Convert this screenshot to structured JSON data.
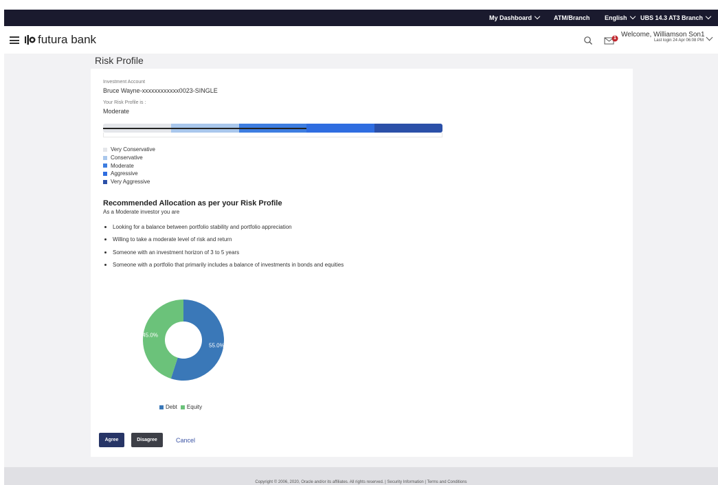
{
  "topbar": {
    "dashboard": "My Dashboard",
    "atm_branch": "ATM/Branch",
    "language": "English",
    "branch": "UBS 14.3 AT3 Branch"
  },
  "header": {
    "brand": "futura bank",
    "notification_count": "1",
    "welcome": "Welcome, Williamson Son1",
    "last_login": "Last login 24 Apr 06:08 PM"
  },
  "page": {
    "title": "Risk Profile"
  },
  "account": {
    "label": "Investment Account",
    "value": "Bruce Wayne-xxxxxxxxxxxx0023-SINGLE"
  },
  "risk": {
    "label": "Your Risk Profile is :",
    "value": "Moderate",
    "level_fraction": 0.6,
    "levels": [
      {
        "label": "Very Conservative",
        "color": "#e4e6ea"
      },
      {
        "label": "Conservative",
        "color": "#a9c7ec"
      },
      {
        "label": "Moderate",
        "color": "#3d7de0"
      },
      {
        "label": "Aggressive",
        "color": "#2f6de0"
      },
      {
        "label": "Very Aggressive",
        "color": "#2b50a8"
      }
    ]
  },
  "allocation": {
    "title": "Recommended Allocation as per your Risk Profile",
    "subtitle": "As a Moderate investor you are",
    "bullets": [
      "Looking for a balance between portfolio stability and portfolio appreciation",
      "Willing to take a moderate level of risk and return",
      "Someone with an investment horizon of 3 to 5 years",
      "Someone with a portfolio that primarily includes a balance of investments in bonds and equities"
    ]
  },
  "chart_data": {
    "type": "pie",
    "categories": [
      "Debt",
      "Equity"
    ],
    "values": [
      55.0,
      45.0
    ],
    "labels": [
      "55.0%",
      "45.0%"
    ],
    "colors": [
      "#3a78b8",
      "#6bc27a"
    ],
    "legend_position": "bottom"
  },
  "actions": {
    "agree": "Agree",
    "disagree": "Disagree",
    "cancel": "Cancel"
  },
  "footer": {
    "text": "Copyright © 2006, 2020, Oracle and/or its affiliates. All rights reserved. | Security Information | Terms and Conditions"
  }
}
